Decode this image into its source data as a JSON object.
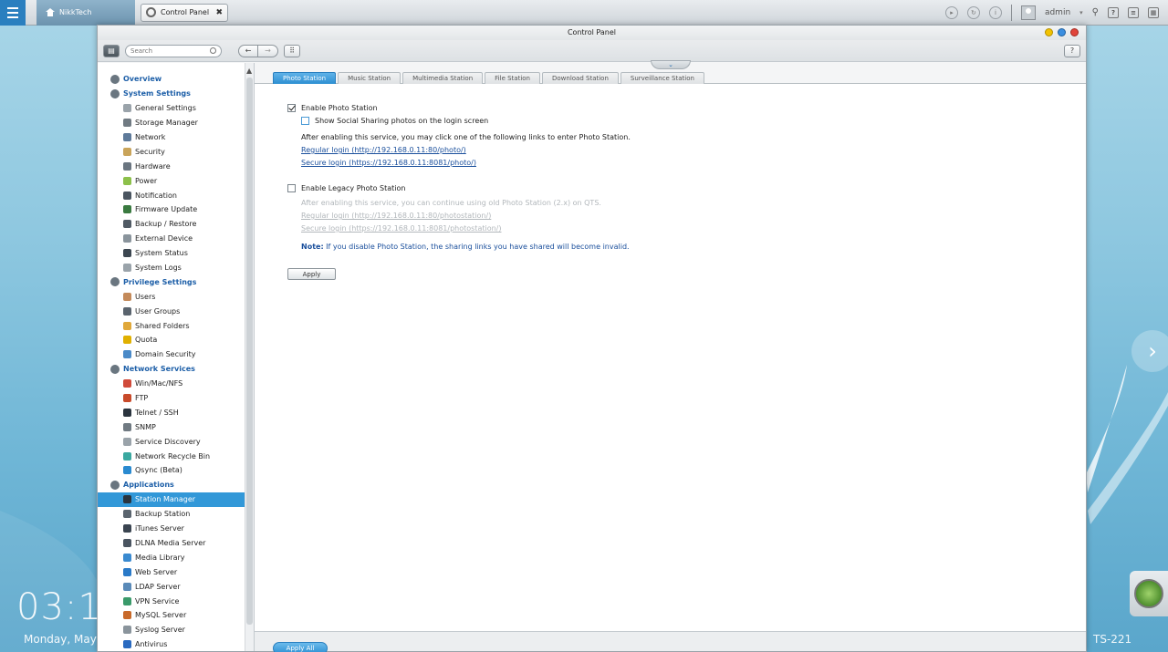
{
  "taskbar": {
    "home_label": "NikkTech",
    "window_tab_label": "Control Panel",
    "close_glyph": "✖",
    "user_name": "admin"
  },
  "window": {
    "title": "Control Panel",
    "search_placeholder": "Search",
    "help_label": "?"
  },
  "sidebar": {
    "items": [
      {
        "label": "Overview",
        "section": true,
        "icon": "overview-icon"
      },
      {
        "label": "System Settings",
        "section": true,
        "icon": "system-settings-icon"
      },
      {
        "label": "General Settings",
        "icon": "general-settings-icon",
        "color": "#9aa3aa"
      },
      {
        "label": "Storage Manager",
        "icon": "storage-manager-icon",
        "color": "#707a82"
      },
      {
        "label": "Network",
        "icon": "network-icon",
        "color": "#5e7a9a"
      },
      {
        "label": "Security",
        "icon": "security-icon",
        "color": "#c9a45a"
      },
      {
        "label": "Hardware",
        "icon": "hardware-icon",
        "color": "#6a7580"
      },
      {
        "label": "Power",
        "icon": "power-icon",
        "color": "#8cc04a"
      },
      {
        "label": "Notification",
        "icon": "notification-icon",
        "color": "#4a5560"
      },
      {
        "label": "Firmware Update",
        "icon": "firmware-update-icon",
        "color": "#3a7a40"
      },
      {
        "label": "Backup / Restore",
        "icon": "backup-restore-icon",
        "color": "#505a64"
      },
      {
        "label": "External Device",
        "icon": "external-device-icon",
        "color": "#8a949c"
      },
      {
        "label": "System Status",
        "icon": "system-status-icon",
        "color": "#3c4650"
      },
      {
        "label": "System Logs",
        "icon": "system-logs-icon",
        "color": "#9aa3aa"
      },
      {
        "label": "Privilege Settings",
        "section": true,
        "icon": "privilege-settings-icon"
      },
      {
        "label": "Users",
        "icon": "users-icon",
        "color": "#c48a5a"
      },
      {
        "label": "User Groups",
        "icon": "user-groups-icon",
        "color": "#5a646e"
      },
      {
        "label": "Shared Folders",
        "icon": "shared-folders-icon",
        "color": "#e0a83a"
      },
      {
        "label": "Quota",
        "icon": "quota-icon",
        "color": "#e0b000"
      },
      {
        "label": "Domain Security",
        "icon": "domain-security-icon",
        "color": "#4a8ac8"
      },
      {
        "label": "Network Services",
        "section": true,
        "icon": "network-services-icon"
      },
      {
        "label": "Win/Mac/NFS",
        "icon": "win-mac-nfs-icon",
        "color": "#d04a3a"
      },
      {
        "label": "FTP",
        "icon": "ftp-icon",
        "color": "#c84a2a"
      },
      {
        "label": "Telnet / SSH",
        "icon": "telnet-ssh-icon",
        "color": "#2a343e"
      },
      {
        "label": "SNMP",
        "icon": "snmp-icon",
        "color": "#707a82"
      },
      {
        "label": "Service Discovery",
        "icon": "service-discovery-icon",
        "color": "#9aa3aa"
      },
      {
        "label": "Network Recycle Bin",
        "icon": "network-recycle-bin-icon",
        "color": "#3aa8a0"
      },
      {
        "label": "Qsync (Beta)",
        "icon": "qsync-icon",
        "color": "#2a8ad0"
      },
      {
        "label": "Applications",
        "section": true,
        "icon": "applications-icon"
      },
      {
        "label": "Station Manager",
        "icon": "station-manager-icon",
        "color": "#2a343e",
        "active": true
      },
      {
        "label": "Backup Station",
        "icon": "backup-station-icon",
        "color": "#5a646e"
      },
      {
        "label": "iTunes Server",
        "icon": "itunes-server-icon",
        "color": "#3a4450"
      },
      {
        "label": "DLNA Media Server",
        "icon": "dlna-media-server-icon",
        "color": "#4a5460"
      },
      {
        "label": "Media Library",
        "icon": "media-library-icon",
        "color": "#3a8ad0"
      },
      {
        "label": "Web Server",
        "icon": "web-server-icon",
        "color": "#2a7ac8"
      },
      {
        "label": "LDAP Server",
        "icon": "ldap-server-icon",
        "color": "#5a8ab8"
      },
      {
        "label": "VPN Service",
        "icon": "vpn-service-icon",
        "color": "#3a9a6a"
      },
      {
        "label": "MySQL Server",
        "icon": "mysql-server-icon",
        "color": "#c86a2a"
      },
      {
        "label": "Syslog Server",
        "icon": "syslog-server-icon",
        "color": "#8a949c"
      },
      {
        "label": "Antivirus",
        "icon": "antivirus-icon",
        "color": "#2a6ac0"
      }
    ]
  },
  "tabs": [
    {
      "label": "Photo Station",
      "active": true
    },
    {
      "label": "Music Station"
    },
    {
      "label": "Multimedia Station"
    },
    {
      "label": "File Station"
    },
    {
      "label": "Download Station"
    },
    {
      "label": "Surveillance Station"
    }
  ],
  "photo_station": {
    "enable_label": "Enable Photo Station",
    "enable_checked": true,
    "social_label": "Show Social Sharing photos on the login screen",
    "social_checked": false,
    "info_text": "After enabling this service, you may click one of the following links to enter Photo Station.",
    "regular_login": "Regular login (http://192.168.0.11:80/photo/)",
    "secure_login": "Secure login (https://192.168.0.11:8081/photo/)",
    "legacy_label": "Enable Legacy Photo Station",
    "legacy_checked": false,
    "legacy_info": "After enabling this service, you can continue using old Photo Station (2.x) on QTS.",
    "legacy_regular": "Regular login (http://192.168.0.11:80/photostation/)",
    "legacy_secure": "Secure login (https://192.168.0.11:8081/photostation/)",
    "note_label": "Note:",
    "note_text": " If you disable Photo Station, the sharing links you have shared will become invalid.",
    "apply_label": "Apply",
    "apply_all_label": "Apply All"
  },
  "desktop": {
    "clock": "03:1",
    "date": "Monday, May",
    "model": "TS-221"
  },
  "colors": {
    "accent": "#3298d8",
    "link": "#1a4f9c",
    "section": "#1d5fa8"
  }
}
